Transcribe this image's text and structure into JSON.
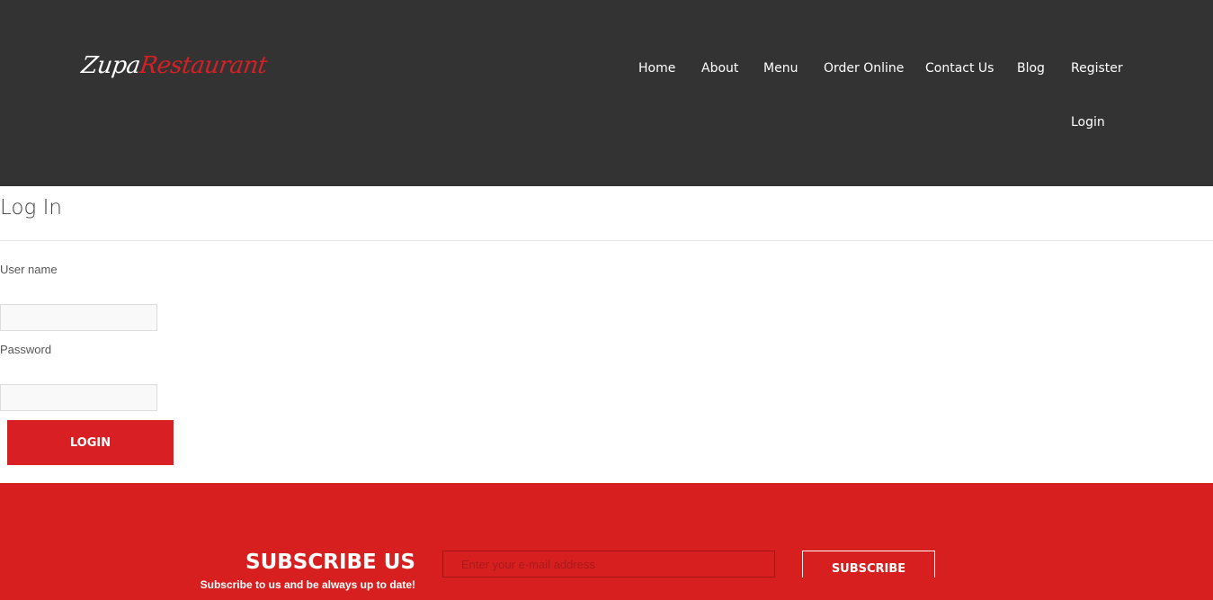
{
  "brand": {
    "part1": "Zupa",
    "part2": "Restaurant",
    "accent_color": "#d81f24",
    "header_color": "#333333"
  },
  "nav": {
    "home": "Home",
    "about": "About",
    "menu": "Menu",
    "order_online": "Order Online",
    "contact_us": "Contact Us",
    "blog": "Blog",
    "register": "Register",
    "login": "Login"
  },
  "login_form": {
    "title": "Log In",
    "username_label": "User name",
    "username_value": "",
    "password_label": "Password",
    "password_value": "",
    "submit_label": "LOGIN"
  },
  "subscribe": {
    "title": "SUBSCRIBE US",
    "subtitle": "Subscribe to us and be always up to date!",
    "email_placeholder": "Enter your e-mail address",
    "button_label": "SUBSCRIBE",
    "background_color": "#d81f1f"
  }
}
